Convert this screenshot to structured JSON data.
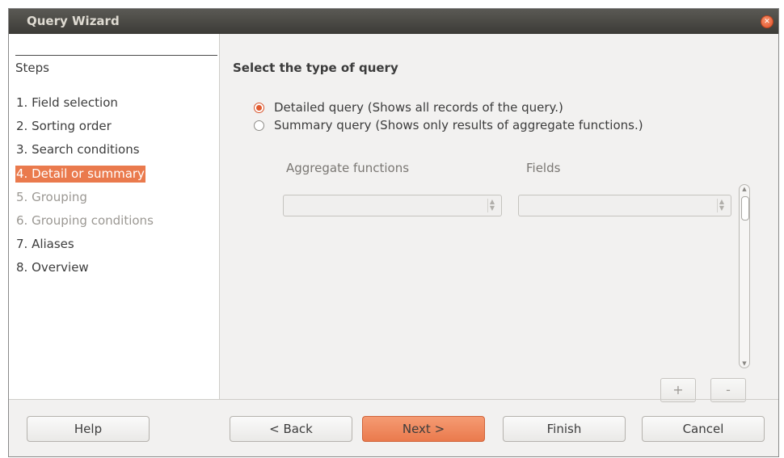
{
  "window": {
    "title": "Query Wizard"
  },
  "steps": {
    "title": "Steps",
    "items": [
      {
        "label": "1. Field selection",
        "state": "normal"
      },
      {
        "label": "2. Sorting order",
        "state": "normal"
      },
      {
        "label": "3. Search conditions",
        "state": "normal"
      },
      {
        "label": "4. Detail or summary",
        "state": "active"
      },
      {
        "label": "5. Grouping",
        "state": "disabled"
      },
      {
        "label": "6. Grouping conditions",
        "state": "disabled"
      },
      {
        "label": "7. Aliases",
        "state": "normal"
      },
      {
        "label": "8. Overview",
        "state": "normal"
      }
    ]
  },
  "main": {
    "heading": "Select the type of query",
    "options": [
      {
        "label": "Detailed query (Shows all records of the query.)",
        "checked": true
      },
      {
        "label": "Summary query (Shows only results of aggregate functions.)",
        "checked": false
      }
    ],
    "aggregate_label": "Aggregate functions",
    "fields_label": "Fields",
    "plus_label": "+",
    "minus_label": "-"
  },
  "buttons": {
    "help": "Help",
    "back": "< Back",
    "next": "Next >",
    "finish": "Finish",
    "cancel": "Cancel"
  },
  "colors": {
    "accent": "#ea7a4d",
    "titlebar": "#3c3b37"
  }
}
